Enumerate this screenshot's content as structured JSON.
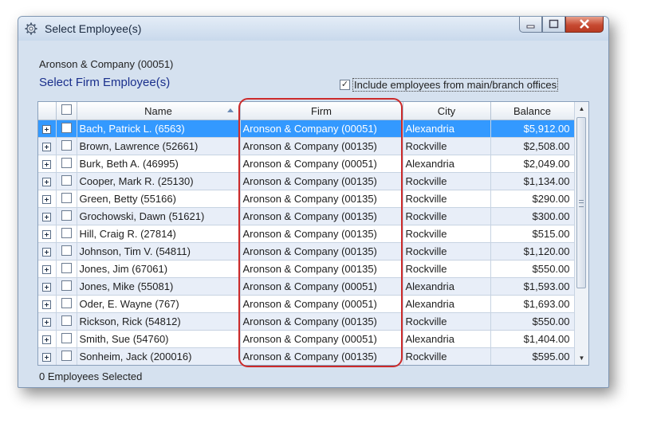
{
  "window": {
    "title": "Select Employee(s)"
  },
  "firm_label": "Aronson & Company (00051)",
  "heading": "Select Firm Employee(s)",
  "include_option": {
    "label": "Include employees from main/branch offices",
    "checked": true
  },
  "columns": {
    "name": "Name",
    "firm": "Firm",
    "city": "City",
    "balance": "Balance"
  },
  "rows": [
    {
      "name": "Bach, Patrick L. (6563)",
      "firm": "Aronson & Company (00051)",
      "city": "Alexandria",
      "balance": "$5,912.00"
    },
    {
      "name": "Brown, Lawrence (52661)",
      "firm": "Aronson & Company (00135)",
      "city": "Rockville",
      "balance": "$2,508.00"
    },
    {
      "name": "Burk, Beth A. (46995)",
      "firm": "Aronson & Company (00051)",
      "city": "Alexandria",
      "balance": "$2,049.00"
    },
    {
      "name": "Cooper, Mark R. (25130)",
      "firm": "Aronson & Company (00135)",
      "city": "Rockville",
      "balance": "$1,134.00"
    },
    {
      "name": "Green, Betty (55166)",
      "firm": "Aronson & Company (00135)",
      "city": "Rockville",
      "balance": "$290.00"
    },
    {
      "name": "Grochowski, Dawn (51621)",
      "firm": "Aronson & Company (00135)",
      "city": "Rockville",
      "balance": "$300.00"
    },
    {
      "name": "Hill, Craig R. (27814)",
      "firm": "Aronson & Company (00135)",
      "city": "Rockville",
      "balance": "$515.00"
    },
    {
      "name": "Johnson, Tim V. (54811)",
      "firm": "Aronson & Company (00135)",
      "city": "Rockville",
      "balance": "$1,120.00"
    },
    {
      "name": "Jones, Jim (67061)",
      "firm": "Aronson & Company (00135)",
      "city": "Rockville",
      "balance": "$550.00"
    },
    {
      "name": "Jones, Mike (55081)",
      "firm": "Aronson & Company (00051)",
      "city": "Alexandria",
      "balance": "$1,593.00"
    },
    {
      "name": "Oder, E. Wayne (767)",
      "firm": "Aronson & Company (00051)",
      "city": "Alexandria",
      "balance": "$1,693.00"
    },
    {
      "name": "Rickson, Rick (54812)",
      "firm": "Aronson & Company (00135)",
      "city": "Rockville",
      "balance": "$550.00"
    },
    {
      "name": "Smith, Sue (54760)",
      "firm": "Aronson & Company (00051)",
      "city": "Alexandria",
      "balance": "$1,404.00"
    },
    {
      "name": "Sonheim, Jack (200016)",
      "firm": "Aronson & Company (00135)",
      "city": "Rockville",
      "balance": "$595.00"
    }
  ],
  "selected_row": 0,
  "status": "0 Employees Selected",
  "colors": {
    "selection": "#3399ff",
    "highlight": "#cc2a2a",
    "heading": "#1a2f8c"
  }
}
